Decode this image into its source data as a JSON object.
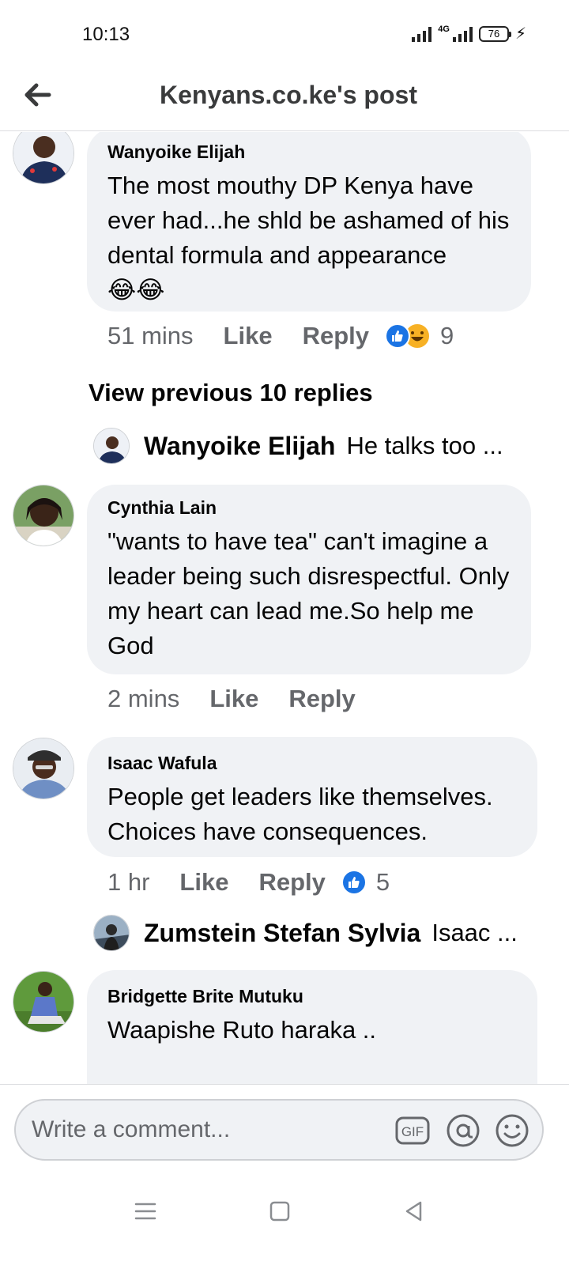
{
  "status_bar": {
    "time": "10:13",
    "network": "4G",
    "battery": "76"
  },
  "header": {
    "title": "Kenyans.co.ke's post"
  },
  "comments": [
    {
      "author": "Wanyoike Elijah",
      "text": "The most mouthy DP Kenya have ever had...he shld be ashamed of his dental formula and appearance",
      "emoji": "😂😂",
      "time": "51 mins",
      "like_label": "Like",
      "reply_label": "Reply",
      "reactions": [
        "like",
        "haha"
      ],
      "reaction_count": "9"
    },
    {
      "author": "Cynthia Lain",
      "text": "\"wants to have tea\" can't imagine a leader being such disrespectful. Only my heart can lead me.So help me God",
      "time": "2 mins",
      "like_label": "Like",
      "reply_label": "Reply"
    },
    {
      "author": "Isaac Wafula",
      "text": "People get leaders like themselves. Choices have consequences.",
      "time": "1 hr",
      "like_label": "Like",
      "reply_label": "Reply",
      "reactions": [
        "like"
      ],
      "reaction_count": "5"
    },
    {
      "author": "Bridgette Brite Mutuku",
      "text": "Waapishe Ruto haraka .."
    }
  ],
  "view_previous_replies": "View previous 10 replies",
  "reply_previews": [
    {
      "author": "Wanyoike Elijah",
      "text": "He talks too ..."
    },
    {
      "author": "Zumstein Stefan Sylvia",
      "text": "Isaac ..."
    }
  ],
  "composer": {
    "placeholder": "Write a comment...",
    "gif_label": "GIF",
    "icons": [
      "gif-icon",
      "mention-icon",
      "emoji-icon"
    ]
  },
  "nav_bar": {
    "icons": [
      "menu-icon",
      "home-icon",
      "back-icon"
    ]
  },
  "colors": {
    "bubble": "#f0f2f5",
    "meta_text": "#65676b",
    "like_blue": "#1b74e4",
    "haha_yellow": "#f7b125"
  }
}
